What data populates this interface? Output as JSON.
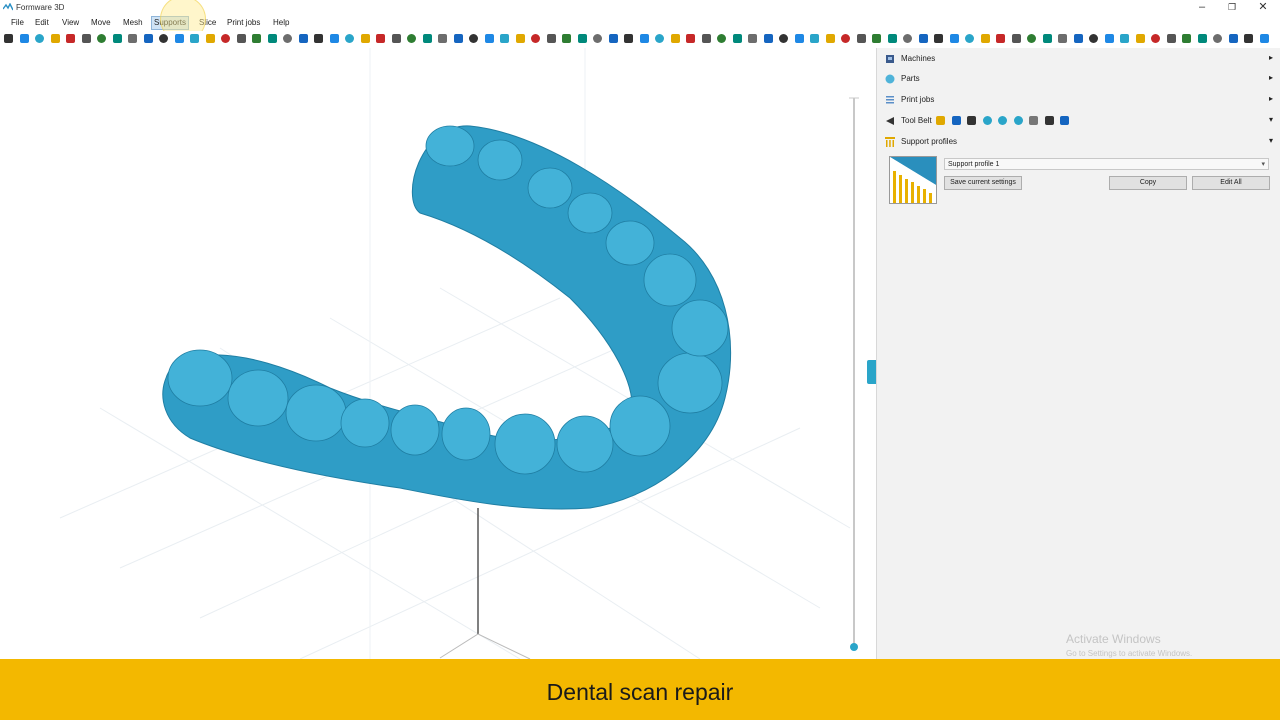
{
  "window": {
    "title": "Formware 3D",
    "minimize": "–",
    "restore": "❐",
    "close": "✕"
  },
  "menu": {
    "items": [
      {
        "key": "file",
        "label": "File"
      },
      {
        "key": "edit",
        "label": "Edit"
      },
      {
        "key": "view",
        "label": "View"
      },
      {
        "key": "move",
        "label": "Move"
      },
      {
        "key": "mesh",
        "label": "Mesh"
      },
      {
        "key": "supports",
        "label": "Supports"
      },
      {
        "key": "slice",
        "label": "Slice"
      },
      {
        "key": "print-jobs",
        "label": "Print jobs"
      },
      {
        "key": "help",
        "label": "Help"
      }
    ],
    "active": "Supports"
  },
  "panel": {
    "machines": "Machines",
    "parts": "Parts",
    "print_jobs": "Print jobs",
    "tool_belt": "Tool Belt",
    "support_profiles": "Support profiles",
    "expand_arrow": "▸",
    "collapse_arrow": "▾"
  },
  "support_profile": {
    "selected": "Support profile 1",
    "save_label": "Save current settings",
    "copy_label": "Copy",
    "edit_all_label": "Edit All"
  },
  "watermark": {
    "line1": "Activate Windows",
    "line2": "Go to Settings to activate Windows."
  },
  "caption": "Dental scan repair",
  "colors": {
    "model": "#2f9dc6",
    "caption_bar": "#f3b800",
    "accent": "#2aa5c9"
  }
}
